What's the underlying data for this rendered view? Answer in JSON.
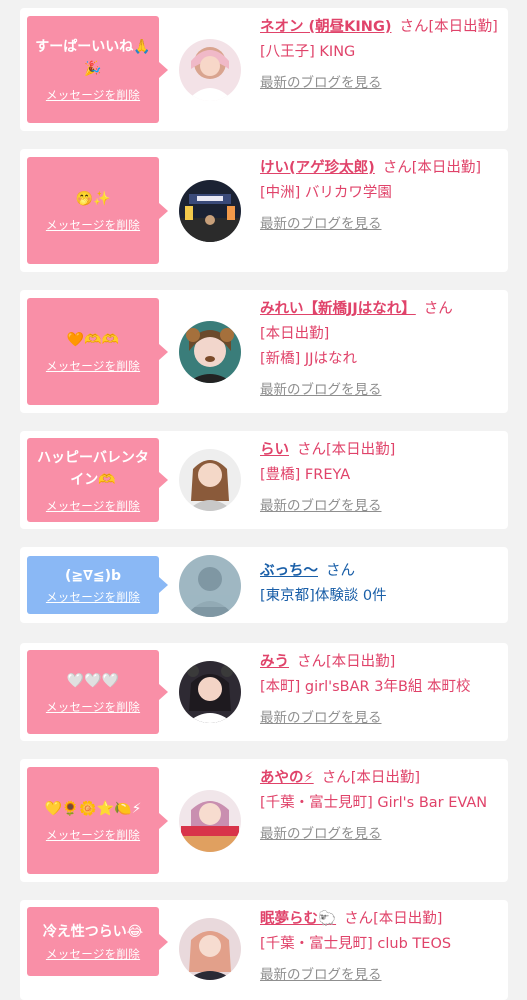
{
  "ui": {
    "delete_label": "メッセージを削除",
    "blog_label": "最新のブログを見る",
    "san_suffix": "さん",
    "colors": {
      "pink_bubble": "#f98fa7",
      "blue_bubble": "#8ab8f5",
      "pink_text": "#e0436a",
      "blue_text": "#1a5fa8",
      "link_gray": "#8f8f8f"
    }
  },
  "messages": [
    {
      "message": "すーぱーいいね🙏\n🎉",
      "name": "ネオン (朝昼KING)",
      "status": "[本日出勤]",
      "shop": "[八王子] KING",
      "has_blog": true,
      "bubble_color": "pink"
    },
    {
      "message": "🤭✨",
      "name": "けい(アゲ珍太郎)",
      "status": "[本日出勤]",
      "shop": "[中洲] バリカワ学園",
      "has_blog": true,
      "bubble_color": "pink"
    },
    {
      "message": "🧡🫶🫶",
      "name": "みれい【新橋JJはなれ】",
      "status": "[本日出勤]",
      "shop": "[新橋] JJはなれ",
      "has_blog": true,
      "bubble_color": "pink"
    },
    {
      "message": "ハッピーバレンタ\nイン🫶",
      "name": "らい",
      "status": "[本日出勤]",
      "shop": "[豊橋] FREYA",
      "has_blog": true,
      "bubble_color": "pink"
    },
    {
      "message": "(≧∇≦)b",
      "name": "ぶっち〜",
      "status": "",
      "shop": "[東京都]体験談 0件",
      "has_blog": false,
      "bubble_color": "blue"
    },
    {
      "message": "🤍🤍🤍",
      "name": "みう",
      "status": "[本日出勤]",
      "shop": "[本町] girl'sBAR 3年B組 本町校",
      "has_blog": true,
      "bubble_color": "pink"
    },
    {
      "message": "💛🌻🌼⭐🍋⚡",
      "name": "あやの⚡",
      "status": "[本日出勤]",
      "shop": "[千葉・富士見町] Girl's Bar EVAN",
      "has_blog": true,
      "bubble_color": "pink"
    },
    {
      "message": "冷え性つらい😂",
      "name": "眠夢らむ🐑",
      "status": "[本日出勤]",
      "shop": "[千葉・富士見町] club TEOS",
      "has_blog": true,
      "bubble_color": "pink"
    }
  ]
}
